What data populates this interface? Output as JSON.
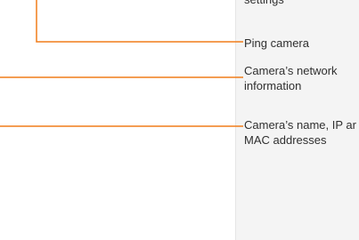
{
  "callouts": {
    "settings": {
      "text": "settings"
    },
    "ping": {
      "text": "Ping camera"
    },
    "network": {
      "line1": "Camera’s network",
      "line2": "information"
    },
    "identity": {
      "line1": "Camera’s name, IP ar",
      "line2": "MAC addresses"
    }
  },
  "colors": {
    "leader": "#f07d1a",
    "panel": "#f4f4f4",
    "text": "#2f2f2f"
  }
}
